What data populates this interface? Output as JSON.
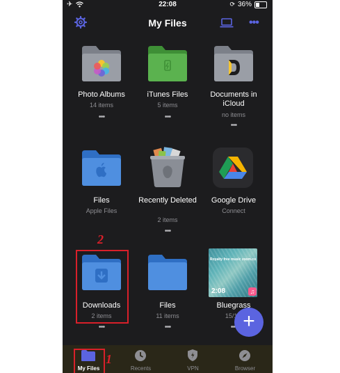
{
  "status": {
    "time": "22:08",
    "battery": "36%"
  },
  "header": {
    "title": "My Files"
  },
  "items": [
    {
      "label": "Photo Albums",
      "sub": "14 items"
    },
    {
      "label": "iTunes Files",
      "sub": "5 items"
    },
    {
      "label": "Documents in iCloud",
      "sub": "no items"
    },
    {
      "label": "Files",
      "sub": "Apple Files"
    },
    {
      "label": "Recently Deleted",
      "sub": "2 items"
    },
    {
      "label": "Google Drive",
      "sub": "Connect"
    },
    {
      "label": "Downloads",
      "sub": "2 items"
    },
    {
      "label": "Files",
      "sub": "11 items"
    },
    {
      "label": "Bluegrass",
      "sub": "15/11/",
      "duration": "2:08",
      "thumb_caption": "Royalty free music zoom.com"
    }
  ],
  "annotations": {
    "step1": "1",
    "step2": "2"
  },
  "tabs": [
    {
      "label": "My Files"
    },
    {
      "label": "Recents"
    },
    {
      "label": "VPN"
    },
    {
      "label": "Browser"
    }
  ],
  "colors": {
    "accent": "#5b64e0",
    "annotation": "#d9202a",
    "folder_blue": "#4f8fe0",
    "folder_grey": "#8a8e96",
    "folder_green": "#4fae45"
  },
  "icons": [
    "wifi-icon",
    "airplane-icon",
    "gear-icon",
    "laptop-icon",
    "more-icon",
    "plus-icon",
    "clock-icon",
    "shield-icon",
    "compass-icon",
    "folder-icon"
  ]
}
